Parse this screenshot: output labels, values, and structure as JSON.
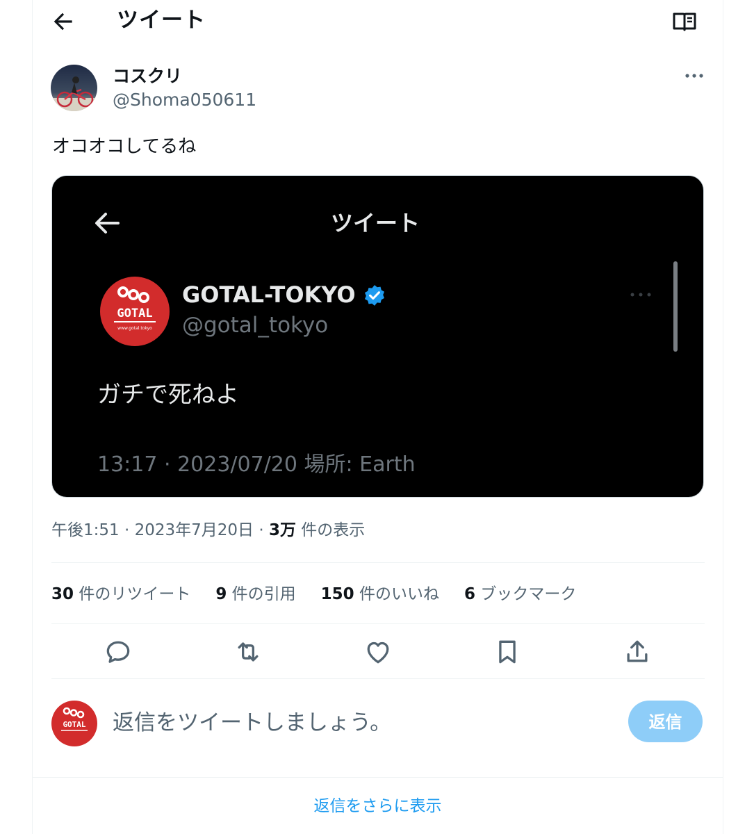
{
  "header": {
    "title": "ツイート"
  },
  "author": {
    "display_name": "コスクリ",
    "handle": "@Shoma050611"
  },
  "tweet": {
    "text": "オコオコしてるね"
  },
  "media": {
    "title": "ツイート",
    "quoted_name": "GOTAL-TOKYO",
    "quoted_handle": "@gotal_tokyo",
    "quoted_text": "ガチで死ねよ",
    "quoted_meta": "13:17 · 2023/07/20 場所: Earth",
    "logo_text": "GOTAL",
    "logo_url_text": "www.gotal.tokyo"
  },
  "meta": {
    "time": "午後1:51",
    "date": "2023年7月20日",
    "views_count": "3万",
    "views_label": "件の表示"
  },
  "stats": [
    {
      "count": "30",
      "label": "件のリツイート"
    },
    {
      "count": "9",
      "label": "件の引用"
    },
    {
      "count": "150",
      "label": "件のいいね"
    },
    {
      "count": "6",
      "label": "ブックマーク"
    }
  ],
  "reply": {
    "placeholder": "返信をツイートしましょう。",
    "button_label": "返信",
    "avatar_text": "GOTAL"
  },
  "footer": {
    "show_more": "返信をさらに表示"
  },
  "colors": {
    "accent": "#1d9bf0",
    "reply_button": "#8ecdf8",
    "verified": "#1d9bf0",
    "logo_red": "#d22c2c"
  }
}
